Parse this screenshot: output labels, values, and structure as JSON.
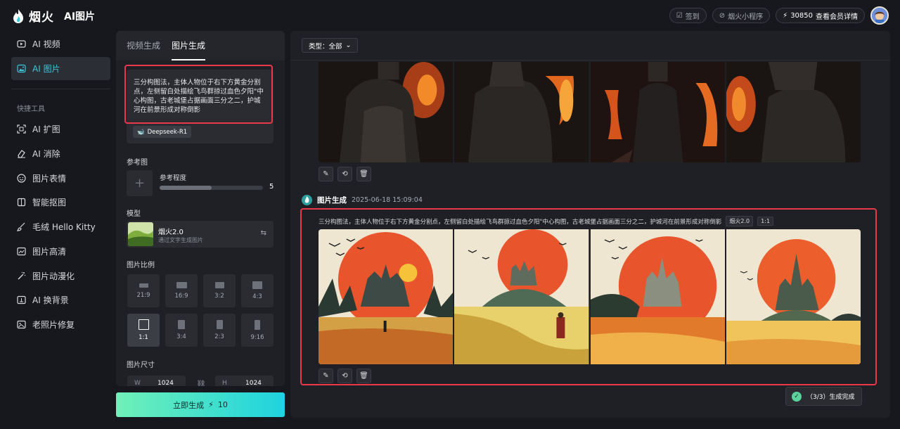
{
  "app": {
    "brand": "烟火",
    "title": "AI图片"
  },
  "topbar": {
    "checkin_label": "签到",
    "miniapp_label": "烟火小程序",
    "credits": "30850",
    "member_label": "查看会员详情"
  },
  "sidebar": {
    "nav": [
      {
        "label": "AI 视频"
      },
      {
        "label": "AI 图片"
      }
    ],
    "tools_heading": "快捷工具",
    "tools": [
      {
        "label": "AI 扩图"
      },
      {
        "label": "AI 消除"
      },
      {
        "label": "图片表情"
      },
      {
        "label": "智能抠图"
      },
      {
        "label": "毛绒 Hello Kitty"
      },
      {
        "label": "图片高清"
      },
      {
        "label": "图片动漫化"
      },
      {
        "label": "AI 换背景"
      },
      {
        "label": "老照片修复"
      }
    ]
  },
  "panel": {
    "tabs": [
      {
        "label": "视频生成"
      },
      {
        "label": "图片生成"
      }
    ],
    "prompt": "三分构图法，主体人物位于右下方黄金分割点，左侧留白处描绘飞鸟群掠过血色夕阳\"中心构图，古老城堡占据画面三分之二，护城河在前景形成对称倒影",
    "deepseek_label": "Deepseek-R1",
    "reference_label": "参考图",
    "reference_strength_label": "参考程度",
    "reference_strength_value": "5",
    "reference_strength_fraction": 0.5,
    "model_label": "模型",
    "model_name": "烟火2.0",
    "model_desc": "通过文字生成图片",
    "ratio_label": "图片比例",
    "ratios": [
      {
        "label": "21:9"
      },
      {
        "label": "16:9"
      },
      {
        "label": "3:2"
      },
      {
        "label": "4:3"
      },
      {
        "label": "1:1"
      },
      {
        "label": "3:4"
      },
      {
        "label": "2:3"
      },
      {
        "label": "9:16"
      }
    ],
    "selected_ratio": "1:1",
    "size_label": "图片尺寸",
    "width_prefix": "W",
    "width_value": "1024",
    "height_prefix": "H",
    "height_value": "1024",
    "generate_label": "立即生成",
    "generate_cost": "10"
  },
  "main": {
    "type_filter_label": "类型：全部",
    "gen_title": "图片生成",
    "gen_time": "2025-06-18 15:09:04",
    "gen_prompt": "三分构图法，主体人物位于右下方黄金分割点，左侧留白处描绘飞鸟群掠过血色夕阳\"中心构图，古老城堡占据画面三分之二，护城河在前景形成对称倒影",
    "tag_model": "烟火2.0",
    "tag_ratio": "1:1"
  },
  "toast": {
    "text": "（3/3）生成完成"
  },
  "colors": {
    "accent": "#3ac9d8",
    "highlight": "#e8384a",
    "gradient_start": "#6ff0b7",
    "gradient_end": "#1ed3df"
  }
}
